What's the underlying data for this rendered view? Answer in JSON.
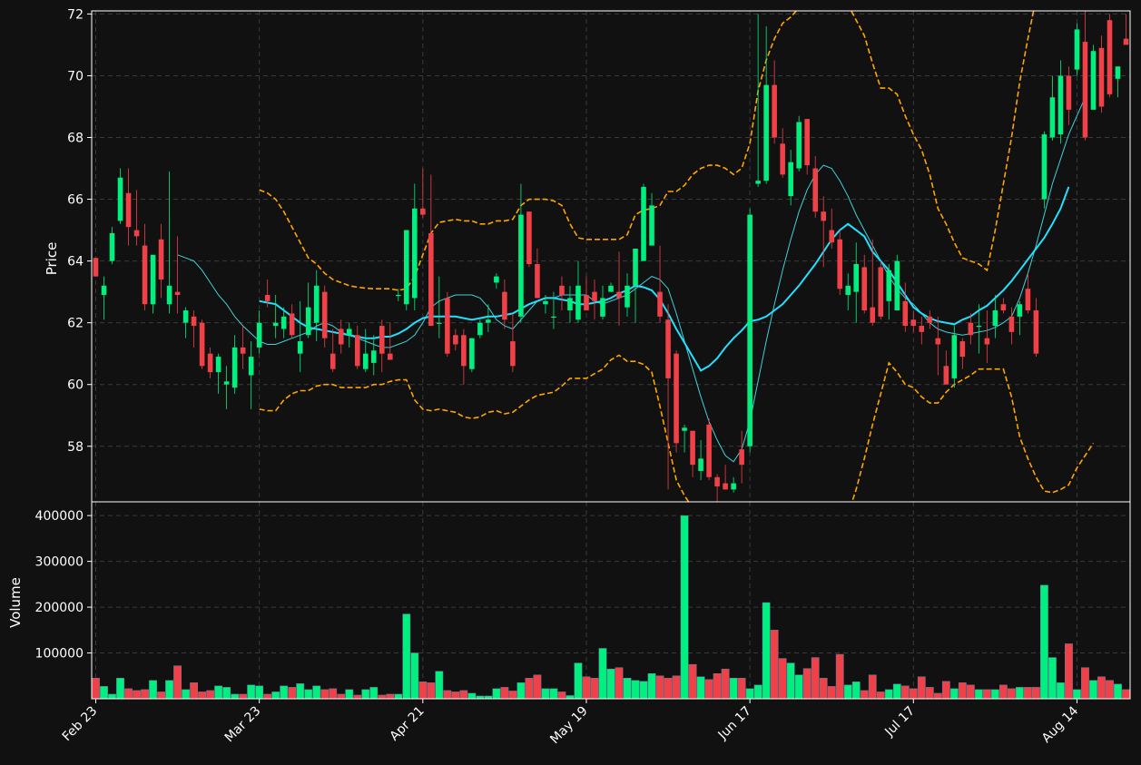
{
  "chart_data": {
    "type": "candlestick",
    "style": {
      "background": "#111111",
      "up_color": "#00f080",
      "down_color": "#f04048",
      "sma20_color": "#22e0ff",
      "sma10_color": "#40d0d8",
      "band_color": "#ffa500",
      "grid_color": "#3a3a3a"
    },
    "price_panel": {
      "ylabel": "Price",
      "ylim": [
        56.2,
        72.1
      ],
      "yticks": [
        58,
        60,
        62,
        64,
        66,
        68,
        70,
        72
      ],
      "grid": true
    },
    "volume_panel": {
      "ylabel": "Volume",
      "ylim": [
        0,
        430000
      ],
      "yticks": [
        100000,
        200000,
        300000,
        400000
      ],
      "grid": true
    },
    "x_ticks": [
      {
        "label": "Feb 23",
        "index": 0
      },
      {
        "label": "Mar 23",
        "index": 20
      },
      {
        "label": "Apr 21",
        "index": 40
      },
      {
        "label": "May 19",
        "index": 60
      },
      {
        "label": "Jun 17",
        "index": 80
      },
      {
        "label": "Jul 17",
        "index": 100
      },
      {
        "label": "Aug 14",
        "index": 120
      }
    ],
    "candles": [
      [
        64.1,
        64.1,
        63.5,
        63.5
      ],
      [
        62.9,
        63.5,
        62.1,
        63.2
      ],
      [
        64.0,
        65.1,
        63.9,
        64.9
      ],
      [
        65.3,
        67.0,
        65.2,
        66.7
      ],
      [
        66.2,
        67.0,
        64.5,
        65.1
      ],
      [
        65.0,
        66.3,
        64.5,
        64.8
      ],
      [
        64.5,
        65.2,
        62.4,
        62.6
      ],
      [
        62.6,
        64.2,
        62.3,
        64.2
      ],
      [
        64.7,
        65.2,
        62.8,
        63.4
      ],
      [
        62.6,
        66.9,
        62.3,
        63.2
      ],
      [
        63.0,
        64.8,
        62.3,
        62.9
      ],
      [
        62.0,
        62.5,
        61.5,
        62.4
      ],
      [
        62.2,
        62.4,
        61.2,
        61.9
      ],
      [
        62.0,
        62.1,
        60.5,
        60.6
      ],
      [
        61.0,
        61.2,
        60.2,
        60.4
      ],
      [
        60.4,
        61.0,
        59.7,
        60.9
      ],
      [
        60.0,
        60.6,
        59.2,
        60.1
      ],
      [
        59.9,
        61.6,
        59.7,
        61.2
      ],
      [
        61.2,
        61.9,
        60.5,
        61.0
      ],
      [
        60.3,
        61.4,
        59.2,
        60.9
      ],
      [
        61.2,
        62.4,
        61.0,
        62.0
      ],
      [
        62.9,
        63.4,
        62.5,
        62.7
      ],
      [
        61.9,
        62.9,
        61.5,
        62.0
      ],
      [
        61.8,
        62.5,
        61.5,
        62.2
      ],
      [
        62.3,
        62.6,
        61.5,
        61.6
      ],
      [
        61.0,
        62.7,
        60.4,
        61.4
      ],
      [
        61.6,
        63.3,
        61.5,
        62.5
      ],
      [
        62.0,
        63.7,
        61.4,
        63.2
      ],
      [
        63.0,
        63.2,
        61.2,
        61.5
      ],
      [
        61.0,
        61.8,
        60.4,
        60.5
      ],
      [
        61.8,
        62.1,
        61.0,
        61.3
      ],
      [
        61.6,
        62.0,
        61.2,
        61.8
      ],
      [
        61.6,
        61.9,
        60.5,
        60.6
      ],
      [
        60.5,
        61.8,
        60.4,
        61.0
      ],
      [
        60.7,
        61.6,
        60.3,
        61.1
      ],
      [
        61.9,
        62.1,
        60.4,
        61.0
      ],
      [
        61.0,
        62.0,
        60.8,
        60.8
      ],
      [
        62.9,
        63.1,
        62.7,
        62.9
      ],
      [
        62.6,
        65.0,
        62.4,
        65.0
      ],
      [
        62.8,
        66.5,
        62.4,
        65.7
      ],
      [
        65.7,
        67.0,
        65.4,
        65.5
      ],
      [
        64.9,
        66.8,
        62.2,
        61.9
      ],
      [
        62.0,
        63.5,
        61.5,
        62.0
      ],
      [
        62.8,
        63.0,
        60.9,
        61.0
      ],
      [
        61.6,
        61.8,
        61.1,
        61.3
      ],
      [
        61.6,
        61.8,
        60.0,
        60.6
      ],
      [
        60.5,
        61.5,
        60.4,
        61.5
      ],
      [
        61.6,
        62.1,
        61.5,
        62.0
      ],
      [
        62.0,
        62.6,
        61.7,
        62.1
      ],
      [
        63.3,
        63.6,
        63.1,
        63.5
      ],
      [
        63.0,
        63.4,
        61.8,
        62.1
      ],
      [
        61.4,
        62.3,
        60.4,
        60.6
      ],
      [
        62.2,
        66.5,
        62.0,
        65.5
      ],
      [
        65.6,
        65.6,
        63.8,
        63.9
      ],
      [
        63.9,
        64.4,
        62.8,
        62.8
      ],
      [
        62.6,
        62.9,
        62.3,
        62.7
      ],
      [
        62.2,
        63.0,
        61.8,
        62.2
      ],
      [
        63.2,
        63.5,
        62.4,
        62.9
      ],
      [
        62.4,
        63.2,
        62.0,
        62.8
      ],
      [
        62.1,
        64.0,
        62.0,
        63.2
      ],
      [
        62.9,
        63.5,
        62.4,
        62.4
      ],
      [
        63.0,
        63.4,
        62.1,
        62.7
      ],
      [
        62.2,
        63.2,
        62.1,
        62.8
      ],
      [
        63.0,
        63.3,
        63.0,
        63.2
      ],
      [
        63.0,
        64.3,
        61.9,
        62.8
      ],
      [
        62.5,
        63.6,
        62.2,
        63.2
      ],
      [
        63.2,
        64.4,
        62.0,
        64.4
      ],
      [
        64.0,
        66.5,
        64.0,
        66.4
      ],
      [
        64.5,
        66.2,
        64.5,
        65.8
      ],
      [
        63.0,
        64.5,
        62.0,
        62.2
      ],
      [
        62.1,
        62.6,
        56.6,
        60.2
      ],
      [
        61.0,
        61.1,
        57.8,
        58.1
      ],
      [
        58.5,
        58.7,
        57.8,
        58.6
      ],
      [
        58.5,
        58.5,
        57.0,
        57.4
      ],
      [
        57.2,
        58.2,
        56.9,
        57.6
      ],
      [
        58.7,
        58.9,
        56.9,
        57.0
      ],
      [
        57.0,
        57.1,
        56.2,
        56.7
      ],
      [
        56.8,
        57.4,
        56.6,
        56.6
      ],
      [
        56.6,
        57.0,
        56.5,
        56.8
      ],
      [
        57.9,
        58.5,
        56.8,
        57.4
      ],
      [
        58.0,
        65.7,
        57.8,
        65.5
      ],
      [
        66.5,
        72.0,
        66.4,
        66.6
      ],
      [
        66.6,
        71.6,
        66.5,
        69.7
      ],
      [
        69.7,
        70.5,
        67.8,
        68.0
      ],
      [
        67.8,
        68.3,
        66.7,
        66.8
      ],
      [
        66.1,
        67.6,
        65.8,
        67.2
      ],
      [
        67.0,
        68.7,
        66.9,
        68.5
      ],
      [
        68.6,
        68.6,
        66.8,
        67.1
      ],
      [
        67.0,
        67.4,
        65.4,
        65.6
      ],
      [
        65.6,
        66.1,
        63.8,
        65.3
      ],
      [
        65.0,
        65.7,
        64.4,
        64.6
      ],
      [
        64.7,
        65.0,
        62.9,
        63.1
      ],
      [
        62.9,
        63.6,
        62.4,
        63.2
      ],
      [
        63.0,
        64.6,
        62.0,
        63.9
      ],
      [
        63.8,
        64.2,
        62.3,
        62.4
      ],
      [
        62.5,
        64.7,
        61.9,
        62.0
      ],
      [
        63.8,
        64.0,
        62.1,
        62.2
      ],
      [
        62.7,
        63.9,
        62.1,
        63.7
      ],
      [
        62.4,
        64.2,
        62.4,
        64.0
      ],
      [
        62.7,
        63.3,
        61.7,
        61.9
      ],
      [
        62.1,
        62.4,
        61.7,
        61.9
      ],
      [
        61.9,
        62.2,
        61.3,
        61.7
      ],
      [
        62.2,
        62.4,
        61.8,
        62.0
      ],
      [
        61.5,
        62.2,
        60.3,
        61.3
      ],
      [
        60.6,
        61.1,
        60.0,
        60.0
      ],
      [
        60.2,
        61.9,
        59.9,
        61.6
      ],
      [
        61.4,
        61.5,
        60.5,
        60.9
      ],
      [
        62.0,
        62.3,
        61.3,
        61.6
      ],
      [
        61.9,
        62.6,
        61.0,
        61.9
      ],
      [
        61.5,
        62.4,
        60.7,
        61.3
      ],
      [
        61.9,
        62.9,
        61.5,
        62.4
      ],
      [
        62.6,
        62.8,
        62.3,
        62.4
      ],
      [
        62.2,
        62.5,
        61.3,
        61.7
      ],
      [
        62.2,
        62.7,
        61.6,
        62.6
      ],
      [
        63.1,
        63.6,
        62.3,
        62.4
      ],
      [
        62.4,
        62.8,
        60.9,
        61.0
      ],
      [
        66.0,
        68.2,
        65.7,
        68.1
      ],
      [
        68.0,
        70.0,
        67.9,
        69.3
      ],
      [
        68.1,
        70.5,
        67.8,
        70.0
      ],
      [
        70.0,
        70.3,
        68.4,
        68.9
      ],
      [
        70.2,
        71.7,
        70.0,
        71.5
      ],
      [
        71.1,
        72.1,
        67.9,
        68.0
      ],
      [
        68.9,
        71.0,
        68.9,
        70.8
      ],
      [
        70.9,
        71.3,
        68.8,
        69.0
      ],
      [
        71.8,
        72.0,
        69.3,
        69.4
      ],
      [
        69.9,
        70.2,
        69.3,
        70.3
      ],
      [
        71.2,
        72.0,
        71.0,
        71.0
      ]
    ],
    "volume": [
      45000,
      27000,
      10000,
      45000,
      22000,
      18000,
      20000,
      40000,
      15000,
      40000,
      72000,
      20000,
      35000,
      15000,
      18000,
      28000,
      25000,
      10000,
      10000,
      30000,
      28000,
      10000,
      15000,
      28000,
      25000,
      33000,
      20000,
      28000,
      20000,
      22000,
      10000,
      20000,
      8000,
      20000,
      25000,
      8000,
      10000,
      10000,
      185000,
      100000,
      37000,
      35000,
      60000,
      18000,
      15000,
      18000,
      12000,
      6000,
      6000,
      22000,
      25000,
      17000,
      35000,
      45000,
      52000,
      22000,
      22000,
      15000,
      7000,
      78000,
      48000,
      45000,
      110000,
      65000,
      68000,
      45000,
      40000,
      38000,
      55000,
      50000,
      45000,
      50000,
      400000,
      75000,
      48000,
      42000,
      55000,
      65000,
      45000,
      45000,
      22000,
      30000,
      210000,
      150000,
      88000,
      78000,
      52000,
      66000,
      90000,
      45000,
      27000,
      97000,
      30000,
      37000,
      18000,
      52000,
      15000,
      20000,
      32000,
      28000,
      22000,
      48000,
      25000,
      12000,
      38000,
      22000,
      35000,
      30000,
      20000,
      20000,
      20000,
      30000,
      22000,
      25000,
      25000,
      25000,
      248000,
      90000,
      35000,
      120000,
      20000,
      68000,
      40000,
      48000,
      40000,
      32000,
      20000
    ],
    "sma20": [
      null,
      null,
      null,
      null,
      null,
      null,
      null,
      null,
      null,
      null,
      null,
      null,
      null,
      null,
      null,
      null,
      null,
      null,
      null,
      null,
      62.7,
      62.65,
      62.6,
      62.4,
      62.2,
      62.0,
      61.85,
      61.8,
      61.75,
      61.7,
      61.65,
      61.6,
      61.55,
      61.5,
      61.5,
      61.55,
      61.55,
      61.65,
      61.8,
      62.0,
      62.15,
      62.2,
      62.2,
      62.2,
      62.2,
      62.15,
      62.1,
      62.15,
      62.2,
      62.2,
      62.25,
      62.3,
      62.45,
      62.6,
      62.7,
      62.8,
      62.8,
      62.75,
      62.7,
      62.6,
      62.6,
      62.65,
      62.7,
      62.8,
      62.95,
      63.05,
      63.2,
      63.15,
      63.05,
      62.75,
      62.3,
      61.8,
      61.35,
      60.9,
      60.45,
      60.6,
      60.85,
      61.2,
      61.5,
      61.75,
      62.05,
      62.1,
      62.2,
      62.4,
      62.6,
      62.9,
      63.2,
      63.55,
      63.9,
      64.3,
      64.7,
      65.0,
      65.2,
      65.0,
      64.8,
      64.3,
      64.0,
      63.7,
      63.3,
      62.9,
      62.5,
      62.3,
      62.15,
      62.05,
      62.0,
      61.95,
      62.1,
      62.2,
      62.4,
      62.55,
      62.8,
      63.05,
      63.35,
      63.7,
      64.05,
      64.4,
      64.75,
      65.2,
      65.7,
      66.4,
      null,
      null,
      null,
      null,
      null,
      null,
      null
    ],
    "sma10": [
      null,
      null,
      null,
      null,
      null,
      null,
      null,
      null,
      null,
      null,
      64.2,
      64.1,
      64.0,
      63.7,
      63.3,
      62.9,
      62.6,
      62.2,
      61.9,
      61.65,
      61.4,
      61.3,
      61.3,
      61.4,
      61.5,
      61.6,
      61.7,
      61.9,
      62.0,
      61.9,
      61.7,
      61.6,
      61.5,
      61.4,
      61.3,
      61.2,
      61.2,
      61.3,
      61.4,
      61.6,
      62.0,
      62.5,
      62.7,
      62.8,
      62.9,
      62.9,
      62.9,
      62.8,
      62.5,
      62.1,
      61.9,
      61.8,
      62.1,
      62.4,
      62.7,
      62.8,
      62.8,
      62.9,
      62.9,
      62.9,
      62.9,
      62.7,
      62.6,
      62.7,
      62.8,
      62.9,
      63.1,
      63.3,
      63.5,
      63.4,
      63.1,
      62.3,
      61.4,
      60.5,
      59.6,
      58.8,
      58.2,
      57.7,
      57.5,
      57.9,
      58.8,
      60.1,
      61.4,
      62.6,
      63.7,
      64.7,
      65.6,
      66.3,
      66.8,
      67.1,
      67.0,
      66.6,
      66.1,
      65.5,
      65.0,
      64.5,
      64.0,
      63.5,
      63.1,
      62.8,
      62.6,
      62.3,
      62.0,
      61.8,
      61.7,
      61.65,
      61.6,
      61.65,
      61.7,
      61.75,
      61.85,
      62.0,
      62.2,
      62.8,
      63.6,
      64.5,
      65.5,
      66.5,
      67.3,
      68.1,
      68.7,
      69.3
    ],
    "bb_upper": [
      null,
      null,
      null,
      null,
      null,
      null,
      null,
      null,
      null,
      null,
      null,
      null,
      null,
      null,
      null,
      null,
      null,
      null,
      null,
      null,
      66.3,
      66.2,
      66.0,
      65.6,
      65.1,
      64.6,
      64.1,
      63.9,
      63.6,
      63.4,
      63.3,
      63.2,
      63.15,
      63.12,
      63.1,
      63.1,
      63.1,
      63.05,
      63.1,
      63.5,
      64.2,
      64.9,
      65.25,
      65.3,
      65.35,
      65.3,
      65.3,
      65.2,
      65.2,
      65.3,
      65.3,
      65.35,
      65.8,
      66.0,
      66.0,
      66.0,
      65.95,
      65.8,
      65.2,
      64.75,
      64.7,
      64.7,
      64.7,
      64.7,
      64.7,
      64.85,
      65.5,
      65.65,
      65.7,
      65.8,
      66.25,
      66.25,
      66.45,
      66.8,
      67.0,
      67.1,
      67.1,
      67.0,
      66.8,
      67.0,
      67.8,
      69.5,
      70.5,
      71.2,
      71.7,
      71.9,
      72.2,
      72.8,
      73.0,
      73.2,
      73.2,
      72.7,
      72.3,
      71.8,
      71.3,
      70.4,
      69.6,
      69.6,
      69.4,
      68.7,
      68.1,
      67.6,
      66.8,
      65.7,
      65.2,
      64.6,
      64.1,
      64.0,
      63.9,
      63.7,
      65.0,
      66.5,
      68.0,
      69.8,
      71.2,
      72.5,
      null,
      null,
      null,
      null,
      null,
      null,
      null,
      null,
      null,
      null,
      null
    ],
    "bb_lower": [
      null,
      null,
      null,
      null,
      null,
      null,
      null,
      null,
      null,
      null,
      null,
      null,
      null,
      null,
      null,
      null,
      null,
      null,
      null,
      null,
      59.2,
      59.15,
      59.15,
      59.5,
      59.7,
      59.8,
      59.8,
      59.95,
      60.0,
      60.0,
      59.9,
      59.9,
      59.9,
      59.9,
      60.0,
      60.0,
      60.1,
      60.15,
      60.15,
      59.5,
      59.2,
      59.15,
      59.2,
      59.15,
      59.1,
      58.95,
      58.9,
      58.95,
      59.1,
      59.15,
      59.05,
      59.1,
      59.3,
      59.5,
      59.65,
      59.7,
      59.75,
      59.95,
      60.2,
      60.2,
      60.2,
      60.35,
      60.5,
      60.8,
      60.95,
      60.75,
      60.75,
      60.65,
      60.4,
      59.3,
      58.1,
      56.9,
      56.4,
      56.0,
      55.5,
      55.3,
      55.1,
      55.0,
      54.9,
      54.7,
      54.4,
      54.0,
      53.6,
      53.3,
      53.1,
      53.0,
      52.8,
      52.9,
      53.2,
      53.6,
      54.1,
      54.9,
      55.8,
      56.6,
      57.6,
      58.7,
      59.7,
      60.7,
      60.4,
      60.0,
      59.9,
      59.6,
      59.4,
      59.4,
      59.75,
      60.0,
      60.15,
      60.3,
      60.5,
      60.5,
      60.5,
      60.5,
      59.6,
      58.3,
      57.6,
      57.0,
      56.55,
      56.5,
      56.6,
      56.75,
      57.3,
      57.7,
      58.1,
      null,
      null,
      null,
      null
    ]
  }
}
